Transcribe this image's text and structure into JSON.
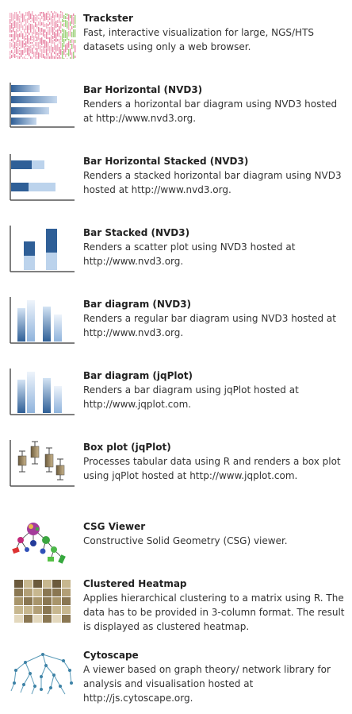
{
  "visualizations": [
    {
      "icon": "trackster-icon",
      "title": "Trackster",
      "description": "Fast, interactive visualization for large, NGS/HTS datasets using only a web browser."
    },
    {
      "icon": "bar-horizontal-icon",
      "title": "Bar Horizontal (NVD3)",
      "description": "Renders a horizontal bar diagram using NVD3 hosted at http://www.nvd3.org."
    },
    {
      "icon": "bar-horizontal-stacked-icon",
      "title": "Bar Horizontal Stacked (NVD3)",
      "description": "Renders a stacked horizontal bar diagram using NVD3 hosted at http://www.nvd3.org."
    },
    {
      "icon": "bar-stacked-icon",
      "title": "Bar Stacked (NVD3)",
      "description": "Renders a scatter plot using NVD3 hosted at http://www.nvd3.org."
    },
    {
      "icon": "bar-diagram-icon",
      "title": "Bar diagram (NVD3)",
      "description": "Renders a regular bar diagram using NVD3 hosted at http://www.nvd3.org."
    },
    {
      "icon": "bar-diagram-icon",
      "title": "Bar diagram (jqPlot)",
      "description": "Renders a bar diagram using jqPlot hosted at http://www.jqplot.com."
    },
    {
      "icon": "box-plot-icon",
      "title": "Box plot (jqPlot)",
      "description": "Processes tabular data using R and renders a box plot using jqPlot hosted at http://www.jqplot.com."
    },
    {
      "icon": "csg-viewer-icon",
      "title": "CSG Viewer",
      "description": "Constructive Solid Geometry (CSG) viewer."
    },
    {
      "icon": "heatmap-icon",
      "title": "Clustered Heatmap",
      "description": "Applies hierarchical clustering to a matrix using R. The data has to be provided in 3-column format. The result is displayed as clustered heatmap."
    },
    {
      "icon": "cytoscape-network-icon",
      "title": "Cytoscape",
      "description": "A viewer based on graph theory/ network library for analysis and visualisation hosted at http://js.cytoscape.org."
    }
  ]
}
